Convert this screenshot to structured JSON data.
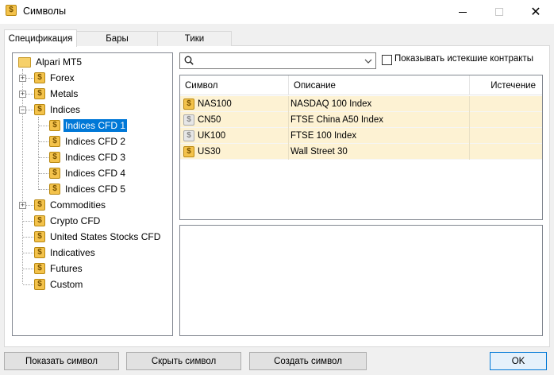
{
  "window": {
    "title": "Символы"
  },
  "tabs": [
    {
      "label": "Спецификация",
      "active": true
    },
    {
      "label": "Бары",
      "active": false
    },
    {
      "label": "Тики",
      "active": false
    }
  ],
  "tree": {
    "root": "Alpari MT5",
    "groups": [
      {
        "label": "Forex",
        "expander": "+"
      },
      {
        "label": "Metals",
        "expander": "+"
      },
      {
        "label": "Indices",
        "expander": "−"
      },
      {
        "label": "Indices CFD 1",
        "selected": true
      },
      {
        "label": "Indices CFD 2"
      },
      {
        "label": "Indices CFD 3"
      },
      {
        "label": "Indices CFD 4"
      },
      {
        "label": "Indices CFD 5"
      },
      {
        "label": "Commodities",
        "expander": "+"
      },
      {
        "label": "Crypto CFD"
      },
      {
        "label": "United States Stocks CFD"
      },
      {
        "label": "Indicatives"
      },
      {
        "label": "Futures"
      },
      {
        "label": "Custom"
      }
    ]
  },
  "search": {
    "value": "",
    "placeholder": ""
  },
  "show_expired": {
    "label": "Показывать истекшие контракты",
    "checked": false
  },
  "grid": {
    "columns": [
      "Символ",
      "Описание",
      "Истечение"
    ],
    "rows": [
      {
        "symbol": "NAS100",
        "description": "NASDAQ 100 Index",
        "expiry": "",
        "active": true
      },
      {
        "symbol": "CN50",
        "description": "FTSE China A50 Index",
        "expiry": "",
        "active": false
      },
      {
        "symbol": "UK100",
        "description": "FTSE 100 Index",
        "expiry": "",
        "active": false
      },
      {
        "symbol": "US30",
        "description": "Wall Street 30",
        "expiry": "",
        "active": true
      }
    ]
  },
  "buttons": {
    "show_symbol": "Показать символ",
    "hide_symbol": "Скрыть символ",
    "create_symbol": "Создать символ",
    "ok": "OK"
  },
  "icons": {
    "symbol_char": "$",
    "close_char": "✕"
  },
  "colors": {
    "selection": "#0078d7",
    "row_highlight": "#fdf2d3",
    "symbol_gold": "#f3c24b"
  }
}
